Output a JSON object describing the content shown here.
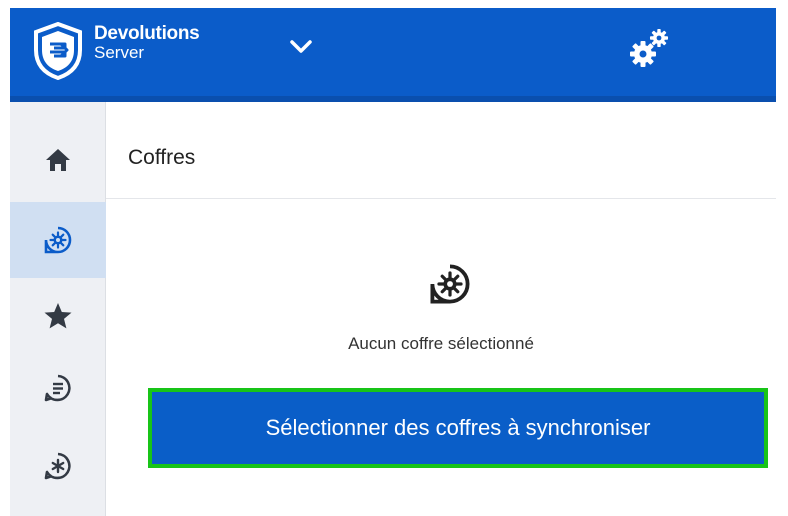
{
  "app": {
    "brand_name": "Devolutions",
    "brand_product": "Server",
    "accent": "#0b5cc9"
  },
  "header": {
    "menu_icon": "chevron-down-icon",
    "settings_icon": "gears-icon"
  },
  "sidebar": {
    "items": [
      {
        "icon": "home-icon",
        "active": false
      },
      {
        "icon": "vault-icon",
        "active": true
      },
      {
        "icon": "star-icon",
        "active": false
      },
      {
        "icon": "chat-sync-icon",
        "active": false
      },
      {
        "icon": "asterisk-sync-icon",
        "active": false
      }
    ]
  },
  "main": {
    "title": "Coffres",
    "empty_icon": "vault-icon",
    "empty_message": "Aucun coffre sélectionné",
    "select_button_label": "Sélectionner des coffres à synchroniser",
    "highlight_color": "#18c418"
  }
}
